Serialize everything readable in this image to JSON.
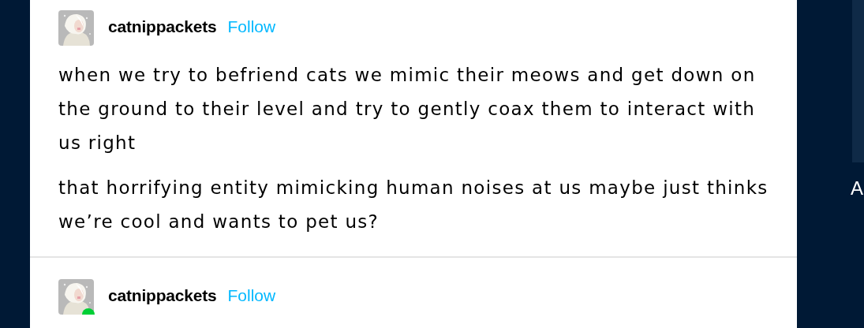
{
  "posts": [
    {
      "username": "catnippackets",
      "follow": "Follow",
      "paragraphs": [
        "when we try to befriend cats we mimic their meows and get down on the ground to their level and try to gently coax them to interact with us right",
        "that horrifying entity mimicking human noises at us maybe just thinks we’re cool and wants to pet us?"
      ]
    },
    {
      "username": "catnippackets",
      "follow": "Follow",
      "badge": true
    }
  ],
  "sidebar": {
    "heading": "A"
  }
}
